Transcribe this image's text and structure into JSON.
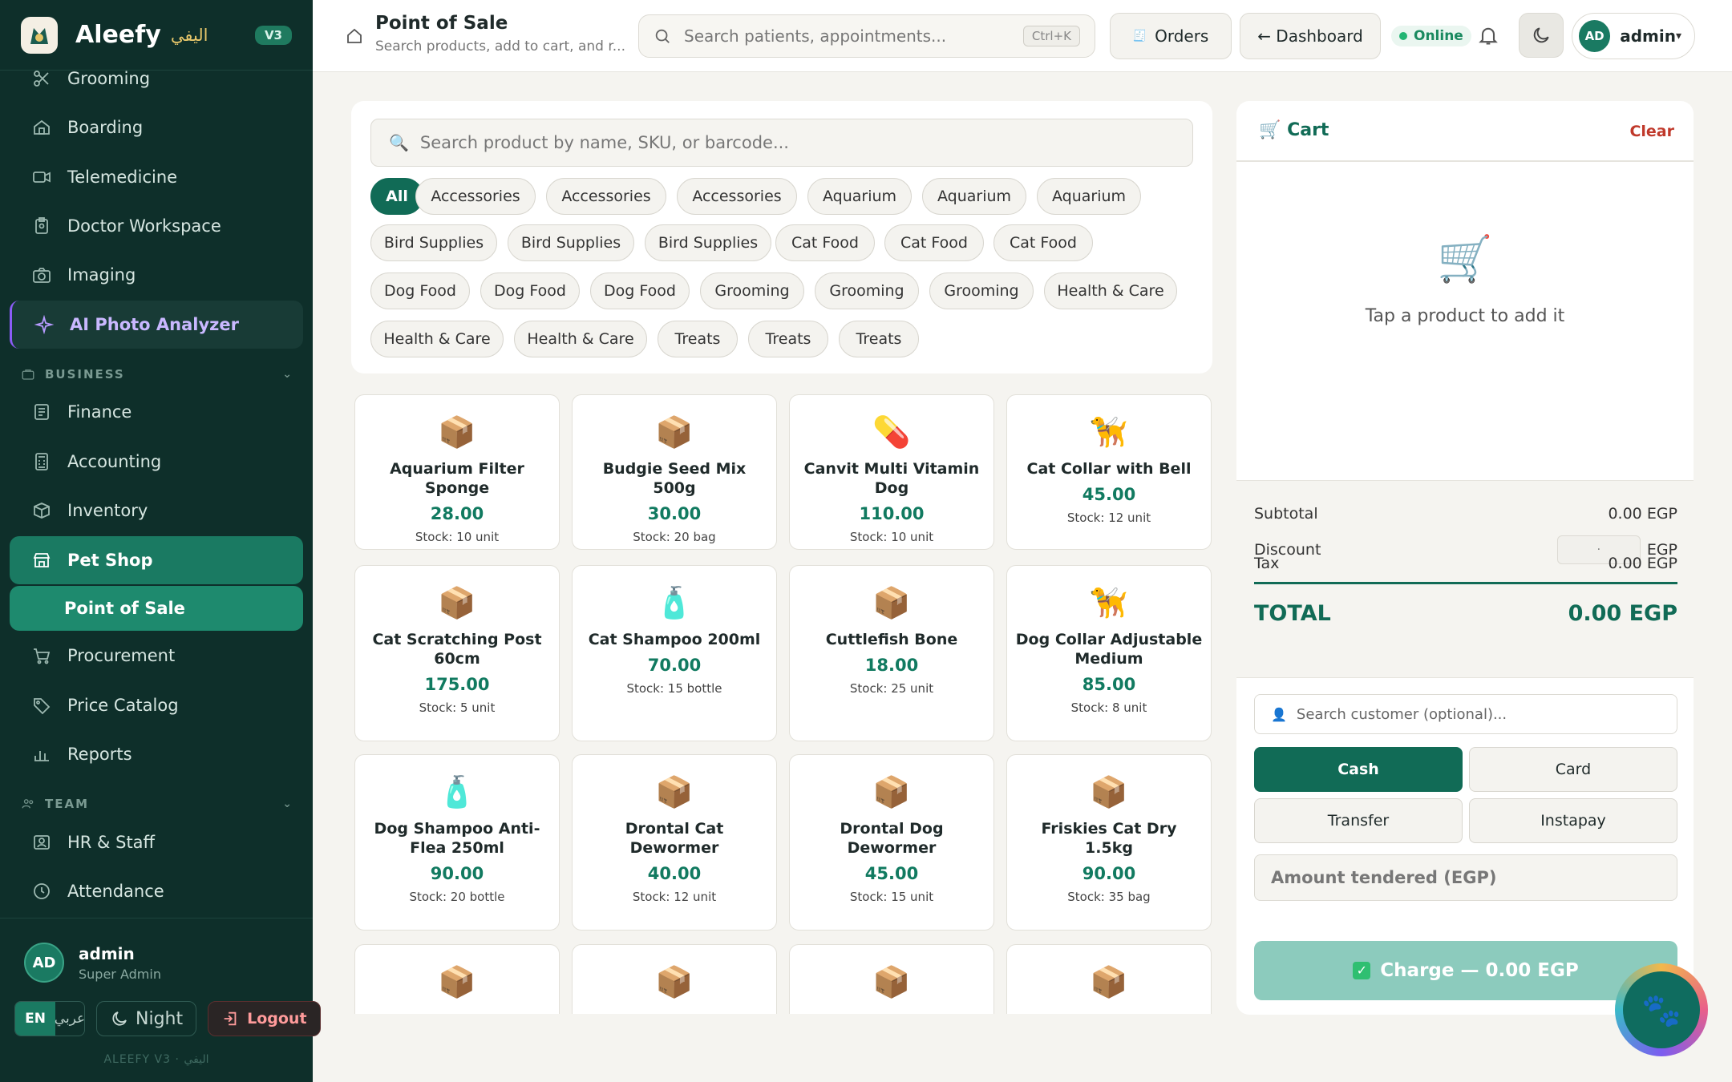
{
  "brand": {
    "name": "Aleefy",
    "name_ar": "اليفي",
    "version": "V3"
  },
  "sidebar": {
    "items": [
      {
        "label": "Grooming",
        "icon": "scissors-icon"
      },
      {
        "label": "Boarding",
        "icon": "home-icon"
      },
      {
        "label": "Telemedicine",
        "icon": "video-icon"
      },
      {
        "label": "Doctor Workspace",
        "icon": "clipboard-icon"
      },
      {
        "label": "Imaging",
        "icon": "camera-icon"
      },
      {
        "label": "AI Photo Analyzer",
        "icon": "sparkle-icon"
      }
    ],
    "business_label": "BUSINESS",
    "business_items": [
      {
        "label": "Finance",
        "icon": "ledger-icon"
      },
      {
        "label": "Accounting",
        "icon": "calculator-icon"
      },
      {
        "label": "Inventory",
        "icon": "box-icon"
      },
      {
        "label": "Pet Shop",
        "icon": "store-icon"
      },
      {
        "label": "Point of Sale"
      },
      {
        "label": "Procurement",
        "icon": "cart-icon"
      },
      {
        "label": "Price Catalog",
        "icon": "tag-icon"
      },
      {
        "label": "Reports",
        "icon": "bar-chart-icon"
      }
    ],
    "team_label": "TEAM",
    "team_items": [
      {
        "label": "HR & Staff",
        "icon": "id-card-icon"
      },
      {
        "label": "Attendance",
        "icon": "clock-icon"
      }
    ],
    "user": {
      "initials": "AD",
      "name": "admin",
      "role": "Super Admin"
    },
    "lang_en": "EN",
    "lang_ar": "عربي",
    "night_label": "Night",
    "logout_label": "Logout",
    "footer_note": "ALEEFY V3 · اليفي"
  },
  "header": {
    "title": "Point of Sale",
    "subtitle": "Search products, add to cart, and r...",
    "search_placeholder": "Search patients, appointments...",
    "shortcut": "Ctrl+K",
    "orders_label": "Orders",
    "dashboard_label": "← Dashboard",
    "status": "Online",
    "user_initials": "AD",
    "user_name": "admin"
  },
  "pos": {
    "search_placeholder": "Search product by name, SKU, or barcode...",
    "categories": [
      "All",
      "Accessories",
      "Accessories",
      "Accessories",
      "Aquarium",
      "Aquarium",
      "Aquarium",
      "Bird Supplies",
      "Bird Supplies",
      "Bird Supplies",
      "Cat Food",
      "Cat Food",
      "Cat Food",
      "Dog Food",
      "Dog Food",
      "Dog Food",
      "Grooming",
      "Grooming",
      "Grooming",
      "Health & Care",
      "Health & Care",
      "Health & Care",
      "Treats",
      "Treats",
      "Treats"
    ],
    "products": [
      {
        "emoji": "📦",
        "name": "Aquarium Filter Sponge",
        "price": "28.00",
        "stock": "Stock: 10 unit"
      },
      {
        "emoji": "📦",
        "name": "Budgie Seed Mix 500g",
        "price": "30.00",
        "stock": "Stock: 20 bag"
      },
      {
        "emoji": "💊",
        "name": "Canvit Multi Vitamin Dog",
        "price": "110.00",
        "stock": "Stock: 10 unit"
      },
      {
        "emoji": "🦮",
        "name": "Cat Collar with Bell",
        "price": "45.00",
        "stock": "Stock: 12 unit"
      },
      {
        "emoji": "📦",
        "name": "Cat Scratching Post 60cm",
        "price": "175.00",
        "stock": "Stock: 5 unit"
      },
      {
        "emoji": "🧴",
        "name": "Cat Shampoo 200ml",
        "price": "70.00",
        "stock": "Stock: 15 bottle"
      },
      {
        "emoji": "📦",
        "name": "Cuttlefish Bone",
        "price": "18.00",
        "stock": "Stock: 25 unit"
      },
      {
        "emoji": "🦮",
        "name": "Dog Collar Adjustable Medium",
        "price": "85.00",
        "stock": "Stock: 8 unit"
      },
      {
        "emoji": "🧴",
        "name": "Dog Shampoo Anti-Flea 250ml",
        "price": "90.00",
        "stock": "Stock: 20 bottle"
      },
      {
        "emoji": "📦",
        "name": "Drontal Cat Dewormer",
        "price": "40.00",
        "stock": "Stock: 12 unit"
      },
      {
        "emoji": "📦",
        "name": "Drontal Dog Dewormer",
        "price": "45.00",
        "stock": "Stock: 15 unit"
      },
      {
        "emoji": "📦",
        "name": "Friskies Cat Dry 1.5kg",
        "price": "90.00",
        "stock": "Stock: 35 bag"
      },
      {
        "emoji": "📦",
        "name": "",
        "price": "",
        "stock": ""
      },
      {
        "emoji": "📦",
        "name": "",
        "price": "",
        "stock": ""
      },
      {
        "emoji": "📦",
        "name": "",
        "price": "",
        "stock": ""
      },
      {
        "emoji": "📦",
        "name": "",
        "price": "",
        "stock": ""
      }
    ]
  },
  "cart": {
    "title": "Cart",
    "clear_label": "Clear",
    "empty_text": "Tap a product to add it",
    "subtotal_label": "Subtotal",
    "subtotal_value": "0.00 EGP",
    "discount_label": "Discount",
    "discount_placeholder": "·",
    "discount_unit": "EGP",
    "tax_label": "Tax",
    "tax_value": "0.00 EGP",
    "total_label": "TOTAL",
    "total_value": "0.00 EGP",
    "customer_placeholder": "Search customer (optional)...",
    "payment_methods": [
      "Cash",
      "Card",
      "Transfer",
      "Instapay"
    ],
    "selected_method": "Cash",
    "amount_placeholder": "Amount tendered (EGP)",
    "charge_label": "Charge — 0.00 EGP"
  },
  "colors": {
    "sidebar": "#0e2f2a",
    "accent": "#116b56",
    "danger": "#c0392b",
    "ai": "#8b5cf6"
  }
}
